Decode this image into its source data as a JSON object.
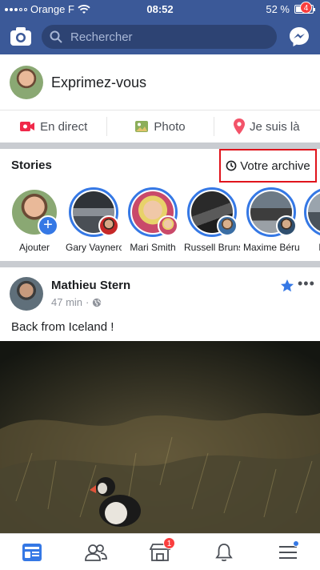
{
  "status_bar": {
    "carrier": "Orange F",
    "time": "08:52",
    "battery_text": "52 %",
    "battery_level": 0.52
  },
  "navbar": {
    "search_placeholder": "Rechercher",
    "messenger_badge": "4",
    "accent": "#3b5998"
  },
  "composer": {
    "prompt": "Exprimez-vous",
    "actions": [
      {
        "label": "En direct",
        "icon": "live-video-icon"
      },
      {
        "label": "Photo",
        "icon": "photo-icon"
      },
      {
        "label": "Je suis là",
        "icon": "location-pin-icon"
      }
    ]
  },
  "stories": {
    "title": "Stories",
    "archive_label": "Votre archive",
    "items": [
      {
        "label": "Ajouter"
      },
      {
        "label": "Gary Vaynerchuk"
      },
      {
        "label": "Mari Smith"
      },
      {
        "label": "Russell Brunson"
      },
      {
        "label": "Maxime Bérubé"
      },
      {
        "label": "Mike"
      }
    ]
  },
  "post": {
    "author": "Mathieu Stern",
    "time": "47 min",
    "text": "Back from Iceland !"
  },
  "tabbar": {
    "marketplace_badge": "1"
  }
}
